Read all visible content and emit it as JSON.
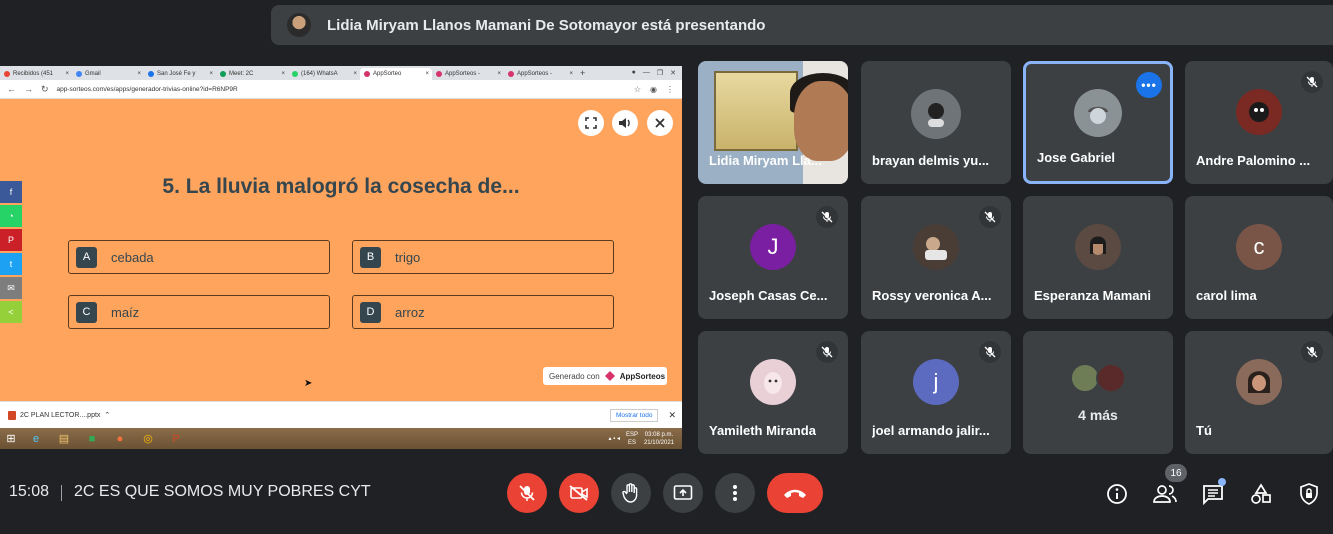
{
  "banner": {
    "presenter_text": "Lidia Miryam Llanos Mamani De Sotomayor está presentando"
  },
  "browser": {
    "tabs": [
      {
        "label": "Recibidos (451",
        "color": "#ea4335"
      },
      {
        "label": "Gmail",
        "color": "#4285f4"
      },
      {
        "label": "San José Fe y",
        "color": "#1a73e8"
      },
      {
        "label": "Meet: 2C",
        "color": "#0f9d58"
      },
      {
        "label": "(164) WhatsA",
        "color": "#25d366"
      },
      {
        "label": "AppSorteo",
        "color": "#d6336c",
        "active": true
      },
      {
        "label": "AppSorteos -",
        "color": "#d6336c"
      },
      {
        "label": "AppSorteos -",
        "color": "#d6336c"
      }
    ],
    "url": "app-sorteos.com/es/apps/generador-trivias-online?id=R6NP9R"
  },
  "trivia": {
    "question": "5.  La lluvia malogró la cosecha de...",
    "options": [
      {
        "letter": "A",
        "text": "cebada"
      },
      {
        "letter": "B",
        "text": "trigo"
      },
      {
        "letter": "C",
        "text": "maíz"
      },
      {
        "letter": "D",
        "text": "arroz"
      }
    ],
    "generated_label": "Generado con",
    "generated_brand": "AppSorteos",
    "share_colors": [
      "#3b5998",
      "#25d366",
      "#cb2027",
      "#1da1f2",
      "#7d7d7d",
      "#95d03a"
    ]
  },
  "downloads": {
    "file": "2C PLAN LECTOR....pptx",
    "show_all": "Mostrar todo"
  },
  "taskbar": {
    "lang_top": "ESP",
    "lang_bottom": "ES",
    "time": "03:08 p.m.",
    "date": "21/10/2021"
  },
  "participants": [
    {
      "name": "Lidia Miryam Lla...",
      "type": "video"
    },
    {
      "name": "brayan delmis yu...",
      "type": "photo",
      "avatar_color": "#6f7478"
    },
    {
      "name": "Jose Gabriel",
      "type": "photo",
      "avatar_color": "#8a9296",
      "active": true
    },
    {
      "name": "Andre Palomino ...",
      "type": "photo",
      "muted": true,
      "avatar_color": "#7a2a22"
    },
    {
      "name": "Joseph Casas Ce...",
      "type": "letter",
      "letter": "J",
      "muted": true,
      "avatar_color": "#7b1fa2"
    },
    {
      "name": "Rossy veronica A...",
      "type": "photo",
      "muted": true,
      "avatar_color": "#4a3d35"
    },
    {
      "name": "Esperanza Mamani",
      "type": "photo",
      "avatar_color": "#5b4a42"
    },
    {
      "name": "carol lima",
      "type": "letter",
      "letter": "c",
      "avatar_color": "#795548"
    },
    {
      "name": "Yamileth Miranda",
      "type": "photo",
      "muted": true,
      "avatar_color": "#e8d0d6"
    },
    {
      "name": "joel armando jalir...",
      "type": "letter",
      "letter": "j",
      "muted": true,
      "avatar_color": "#5c6bc0"
    },
    {
      "name": "4 más",
      "type": "more"
    },
    {
      "name": "Tú",
      "type": "photo",
      "muted": true,
      "avatar_color": "#8a6a5a"
    }
  ],
  "bottom": {
    "time": "15:08",
    "meeting_name": "2C ES QUE SOMOS MUY POBRES CYT",
    "participant_count": "16"
  }
}
